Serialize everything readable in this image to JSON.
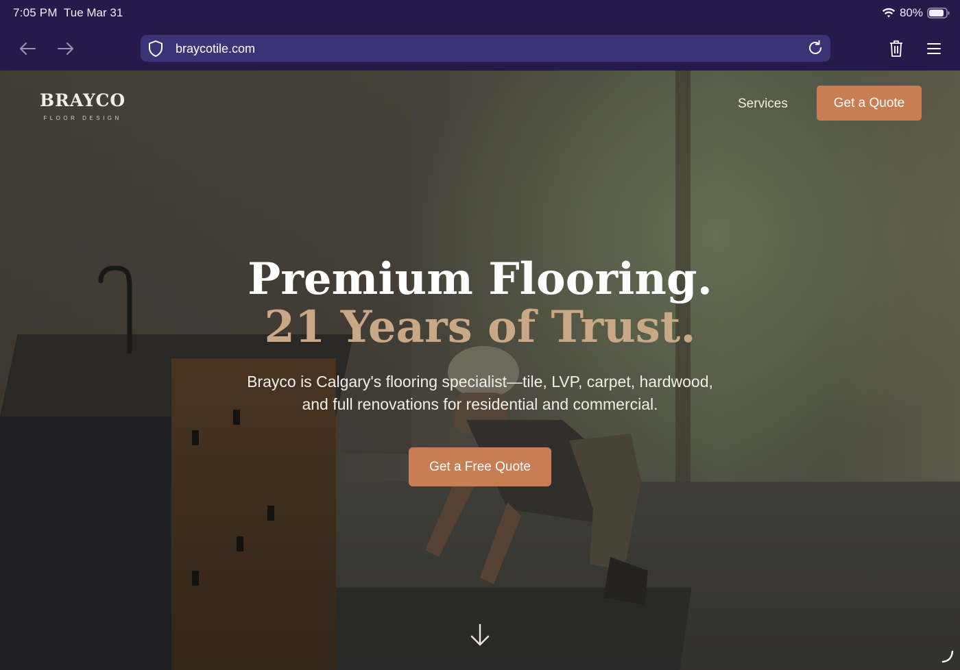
{
  "status_bar": {
    "time": "7:05 PM",
    "date": "Tue Mar 31",
    "battery": "80%",
    "icons": [
      "wifi-icon",
      "battery-icon"
    ]
  },
  "browser": {
    "url": "braycotile.com",
    "icons": [
      "back-arrow-icon",
      "forward-arrow-icon",
      "shield-icon",
      "reload-icon",
      "trash-icon",
      "menu-icon"
    ]
  },
  "site": {
    "logo": {
      "name": "BRAYCO",
      "tagline": "FLOOR DESIGN"
    },
    "nav": {
      "services": "Services",
      "quote_button": "Get a Quote"
    },
    "hero": {
      "headline_line1": "Premium Flooring.",
      "headline_line2": "21 Years of Trust.",
      "subtext_line1": "Brayco is Calgary's flooring specialist—tile, LVP, carpet, hardwood,",
      "subtext_line2": "and full renovations for residential and commercial.",
      "cta": "Get a Free Quote",
      "scroll_icon": "down-arrow-icon"
    }
  },
  "colors": {
    "chrome_bg": "#261a4a",
    "url_bar_bg": "#3d3477",
    "accent": "#c67e52",
    "headline_accent": "#c8a886"
  }
}
